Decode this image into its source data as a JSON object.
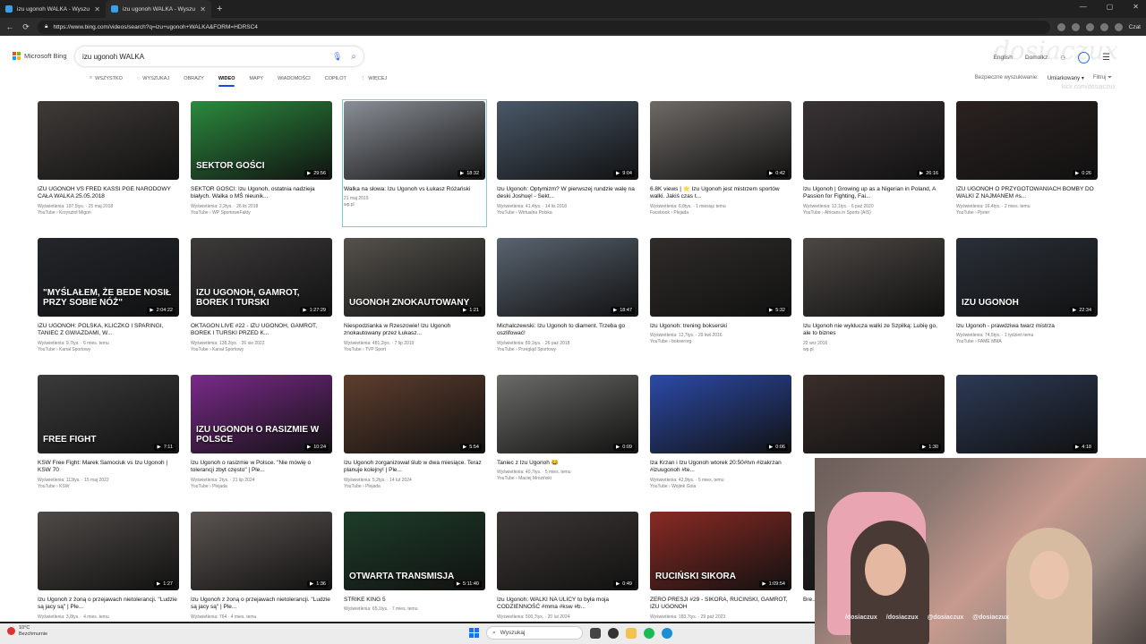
{
  "browser": {
    "tabs": [
      {
        "label": "izu ugonoh WALKA - Wyszukaj",
        "active": false
      },
      {
        "label": "izu ugonoh WALKA - Wyszukaj Fil",
        "active": true
      }
    ],
    "url": "https://www.bing.com/videos/search?q=izu+ugonoh+WALKA&FORM=HDRSC4",
    "copilot_label": "Czat"
  },
  "bing": {
    "logo_text": "Microsoft Bing",
    "query": "izu ugonoh WALKA",
    "header_right": {
      "language": "English",
      "rewards": "Domolkz"
    },
    "scopes": [
      {
        "label": "WSZYSTKO",
        "active": false
      },
      {
        "label": "WYSZUKAJ",
        "active": false
      },
      {
        "label": "OBRAZY",
        "active": false
      },
      {
        "label": "WIDEO",
        "active": true
      },
      {
        "label": "MAPY",
        "active": false
      },
      {
        "label": "WIADOMOŚCI",
        "active": false
      },
      {
        "label": "COPILOT",
        "active": false
      },
      {
        "label": "WIĘCEJ",
        "active": false
      }
    ],
    "filters": {
      "safe_label": "Bezpieczne wyszukiwanie:",
      "safe_value": "Umiarkowany",
      "filter_label": "Filtruj"
    },
    "watermark": "dosiaczux",
    "kick_watermark": "kick.com/dosiaczux"
  },
  "videos": [
    {
      "title": "IZU UGONOH VS FRED KASSI PGE NARODOWY CAŁA WALKA 25.05.2018",
      "meta": "Wyświetlenia: 197,5tys. · 25 maj 2018",
      "source": "YouTube › Krzysztof Migon",
      "duration": "",
      "overlay": "",
      "color": "#3f3b38"
    },
    {
      "title": "SEKTOR GOŚCI: Izu Ugonoh, ostatnia nadzieja białych. Walka o MŚ nieunik...",
      "meta": "Wyświetlenia: 2,2tys. · 26 lis 2018",
      "source": "YouTube › WP SportoweFakty",
      "duration": "29:56",
      "overlay": "SEKTOR GOŚCI",
      "color": "#2b8a3e"
    },
    {
      "title": "Walka na słowa: Izu Ugonoh vs Łukasz Różański",
      "meta": "21 maj 2019",
      "source": "wp.pl",
      "duration": "18:32",
      "overlay": "",
      "color": "#8a8f96"
    },
    {
      "title": "Izu Ugonoh: Optymizm? W pierwszej rundzie walę na deski Joshuę! - Sekt...",
      "meta": "Wyświetlenia: 41,4tys. · 14 lis 2018",
      "source": "YouTube › Wirtualna Polska",
      "duration": "9:04",
      "overlay": "",
      "color": "#4a5868"
    },
    {
      "title": "6.8K views | ⭐ Izu Ugonoh jest mistrzem sportów walki. Jakiś czas t...",
      "meta": "Wyświetlenia: 6,8tys. · 1 miesiąc temu",
      "source": "Facebook › Plejada",
      "duration": "0:42",
      "overlay": "",
      "color": "#6e6a66"
    },
    {
      "title": "Izu Ugonoh | Growing up as a Nigerian in Poland, A Passion for Fighting, Fai...",
      "meta": "Wyświetlenia: 12,1tys. · 6 paź 2020",
      "source": "YouTube › Africans in Sports (AIS)",
      "duration": "26:16",
      "overlay": "",
      "color": "#3a3336"
    },
    {
      "title": "IZU UGONOH O PRZYGOTOWANIACH BOMBY DO WALKI Z NAJMANEM #s...",
      "meta": "Wyświetlenia: 16,4tys. · 2 mies. temu",
      "source": "YouTube › Pjoter",
      "duration": "0:26",
      "overlay": "",
      "color": "#2a2220"
    },
    {
      "title": "IZU UGONOH: POLSKA, KLICZKO I SPARINGI, TANIEC Z GWIAZDAMI, W...",
      "meta": "Wyświetlenia: 9,7tys. · 6 mies. temu",
      "source": "YouTube › Kanał Sportowy",
      "duration": "2:04:22",
      "overlay": "\"MYŚLAŁEM, ŻE BEDE NOSIŁ PRZY SOBIE NÓŻ\"",
      "color": "#24262b"
    },
    {
      "title": "OKTAGON LIVE #22 - IZU UGONOH, GAMROT, BOREK I TURSKI PRZED K...",
      "meta": "Wyświetlenia: 138,2tys. · 26 sie 2022",
      "source": "YouTube › Kanał Sportowy",
      "duration": "1:27:29",
      "overlay": "IZU UGONOH, GAMROT, BOREK I TURSKI",
      "color": "#3d3a3a"
    },
    {
      "title": "Niespodzianka w Rzeszowie! Izu Ugonoh znokautowany przez Łukasz...",
      "meta": "Wyświetlenia: 481,2tys. · 7 lip 2019",
      "source": "YouTube › TVP Sport",
      "duration": "1:21",
      "overlay": "UGONOH ZNOKAUTOWANY",
      "color": "#55524c"
    },
    {
      "title": "Michalczewski: Izu Ugonoh to diament. Trzeba go oszlifować!",
      "meta": "Wyświetlenia: 89,1tys. · 26 paź 2018",
      "source": "YouTube › Przegląd Sportowy",
      "duration": "18:47",
      "overlay": "",
      "color": "#5a6470"
    },
    {
      "title": "Izu Ugonoh: trening bokserski",
      "meta": "Wyświetlenia: 12,7tys. · 29 kwi 2016",
      "source": "YouTube › bokserorg",
      "duration": "5:32",
      "overlay": "",
      "color": "#2f2c2a"
    },
    {
      "title": "Izu Ugonoh nie wyklucza walki ze Szpilką: Lubię go, ale to biznes",
      "meta": "22 wrz 2016",
      "source": "wp.pl",
      "duration": "",
      "overlay": "",
      "color": "#4c4844"
    },
    {
      "title": "Izu Ugonoh - prawdziwa twarz mistrza",
      "meta": "Wyświetlenia: 74,5tys. · 1 tydzień temu",
      "source": "YouTube › FAME MMA",
      "duration": "22:34",
      "overlay": "IZU UGONOH",
      "color": "#2a3038"
    },
    {
      "title": "KSW Free Fight: Marek Samociuk vs Izu Ugonoh | KSW 70",
      "meta": "Wyświetlenia: 113tys. · 15 maj 2022",
      "source": "YouTube › KSW",
      "duration": "7:11",
      "overlay": "FREE FIGHT",
      "color": "#3b3b3b"
    },
    {
      "title": "Izu Ugonoh o rasizmie w Polsce. \"Nie mówię o tolerancji zbyt często\" | Ple...",
      "meta": "Wyświetlenia: 2tys. · 21 lip 2024",
      "source": "YouTube › Plejada",
      "duration": "10:24",
      "overlay": "IZU UGONOH O RASIZMIE W POLSCE",
      "color": "#7a2a8a"
    },
    {
      "title": "Izu Ugonoh zorganizował ślub w dwa miesiące. Teraz planuje kolejny! | Ple...",
      "meta": "Wyświetlenia: 5,2tys. · 14 lut 2024",
      "source": "YouTube › Plejada",
      "duration": "5:54",
      "overlay": "",
      "color": "#5e3e2e"
    },
    {
      "title": "Taniec z Izu Ugonoh 😂",
      "meta": "Wyświetlenia: 40,7tys. · 5 mies. temu",
      "source": "YouTube › Maciej Mroziński",
      "duration": "0:09",
      "overlay": "",
      "color": "#6b6b68"
    },
    {
      "title": "Iza Krzan i Izu Ugonoh wtorek 20:50#tvn #izakrzan #izuugonoh #te...",
      "meta": "Wyświetlenia: 42,9tys. · 5 mies. temu",
      "source": "YouTube › Wojtek Gola",
      "duration": "0:06",
      "overlay": "",
      "color": "#2c4aa8"
    },
    {
      "title": "",
      "meta": "",
      "source": "",
      "duration": "1:30",
      "overlay": "",
      "color": "#3a2e2a"
    },
    {
      "title": "",
      "meta": "",
      "source": "",
      "duration": "4:18",
      "overlay": "",
      "color": "#2d3a55"
    },
    {
      "title": "Izu Ugonoh z żoną o przejawach nietolerancji. \"Ludzie są jacy są\" | Ple...",
      "meta": "Wyświetlenia: 3,8tys. · 4 mies. temu",
      "source": "",
      "duration": "1:27",
      "overlay": "",
      "color": "#4e4a47"
    },
    {
      "title": "Izu Ugonoh z żoną o przejawach nietolerancji. \"Ludzie są jacy są\" | Ple...",
      "meta": "Wyświetlenia: 764 · 4 mies. temu",
      "source": "",
      "duration": "1:36",
      "overlay": "",
      "color": "#5b5552"
    },
    {
      "title": "STRIKE KING 5",
      "meta": "Wyświetlenia: 65,1tys. · 7 mies. temu",
      "source": "",
      "duration": "5:11:40",
      "overlay": "OTWARTA TRANSMISJA",
      "color": "#1e3d2a"
    },
    {
      "title": "Izu Ugonoh: WALKI NA ULICY to była moja CODZIENNOŚĆ #mma #ksw #b...",
      "meta": "Wyświetlenia: 500,7tys. · 20 lut 2024",
      "source": "",
      "duration": "0:49",
      "overlay": "",
      "color": "#3c3735"
    },
    {
      "title": "ZERO PRESJI #29 - SIKORA, RUCIŃSKI, GAMROT, IZU UGONOH",
      "meta": "Wyświetlenia: 183,7tys. · 29 paź 2023",
      "source": "",
      "duration": "1:09:54",
      "overlay": "RUCIŃSKI   SIKORA",
      "color": "#8a2a24"
    },
    {
      "title": "Bre... 201...",
      "meta": "",
      "source": "",
      "duration": "",
      "overlay": "",
      "color": "#222"
    }
  ],
  "webcam": {
    "socials": [
      "/dosiaczux",
      "/dosiaczux",
      "@dosiaczux",
      "@dosiaczux"
    ]
  },
  "taskbar": {
    "weather_temp": "10°C",
    "weather_desc": "Bezchmurnie",
    "search_placeholder": "Wyszukaj"
  }
}
